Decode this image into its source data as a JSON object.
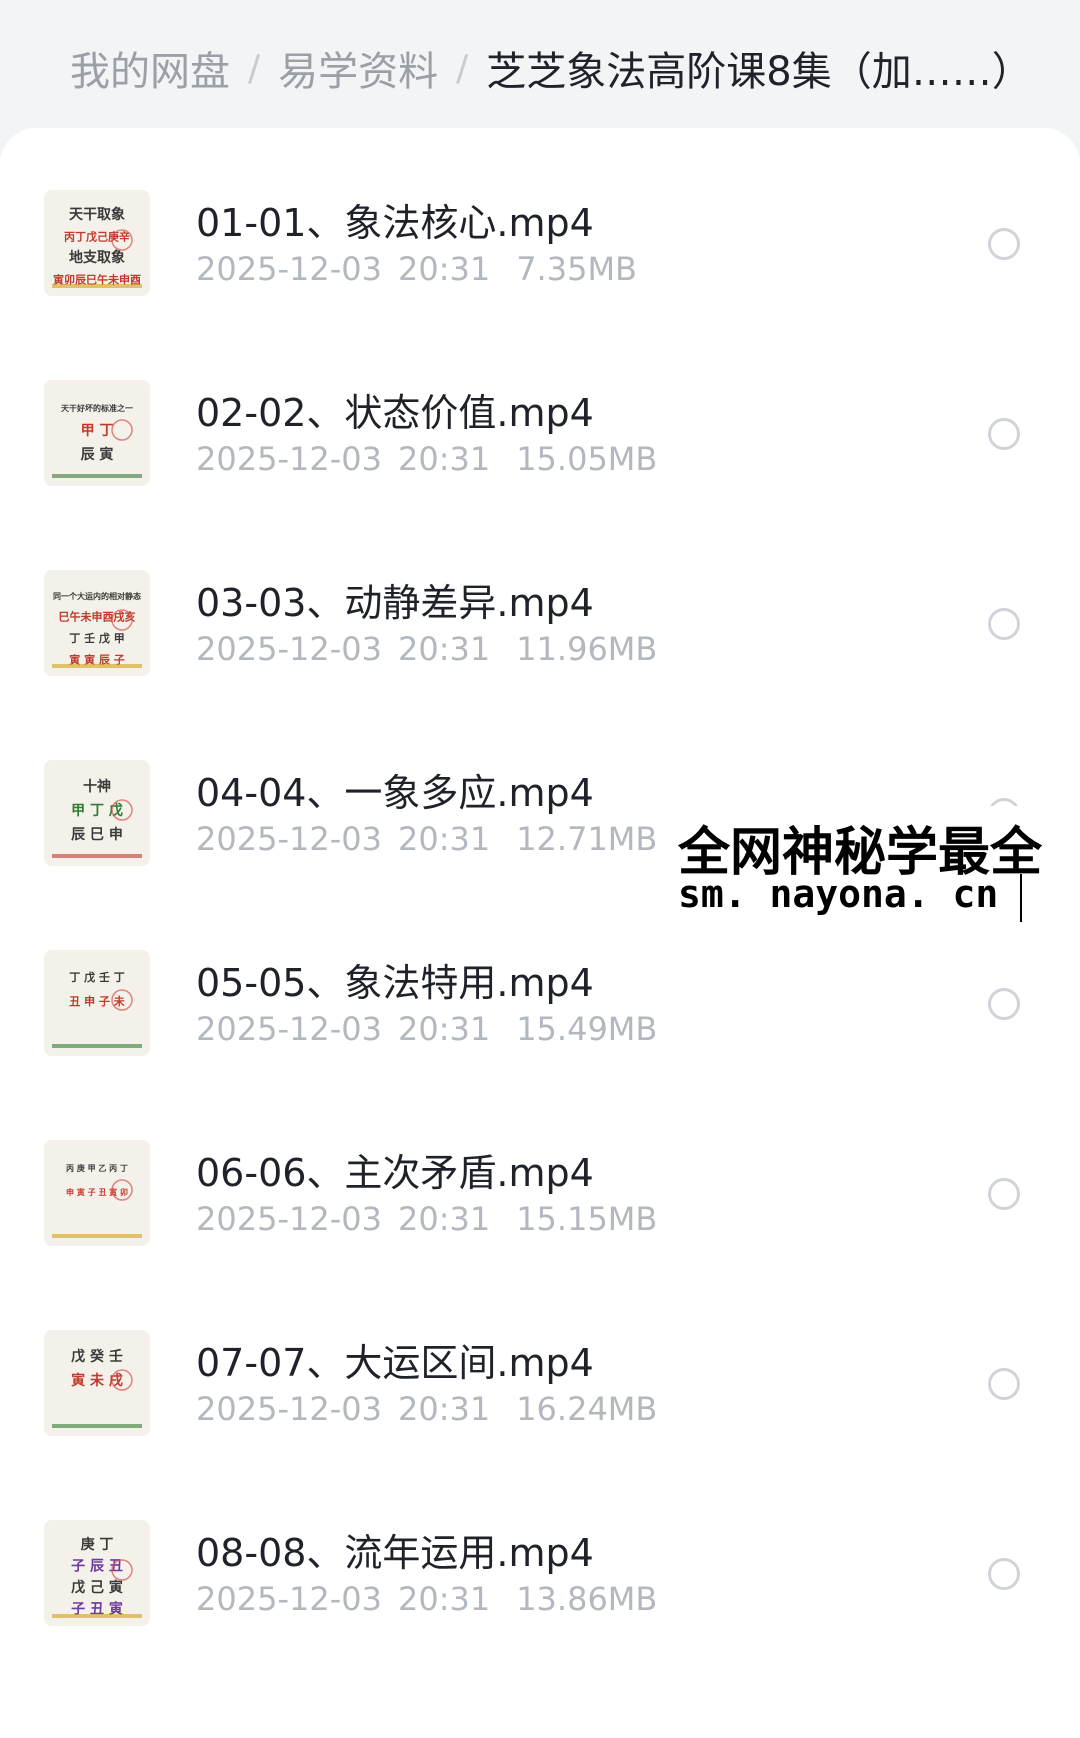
{
  "breadcrumb": {
    "items": [
      "我的网盘",
      "易学资料",
      "芝芝象法高阶课8集（加……）"
    ],
    "separator": "/"
  },
  "files": [
    {
      "name": "01-01、象法核心.mp4",
      "date": "2025-12-03",
      "time": "20:31",
      "size": "7.35MB"
    },
    {
      "name": "02-02、状态价值.mp4",
      "date": "2025-12-03",
      "time": "20:31",
      "size": "15.05MB"
    },
    {
      "name": "03-03、动静差异.mp4",
      "date": "2025-12-03",
      "time": "20:31",
      "size": "11.96MB"
    },
    {
      "name": "04-04、一象多应.mp4",
      "date": "2025-12-03",
      "time": "20:31",
      "size": "12.71MB"
    },
    {
      "name": "05-05、象法特用.mp4",
      "date": "2025-12-03",
      "time": "20:31",
      "size": "15.49MB"
    },
    {
      "name": "06-06、主次矛盾.mp4",
      "date": "2025-12-03",
      "time": "20:31",
      "size": "15.15MB"
    },
    {
      "name": "07-07、大运区间.mp4",
      "date": "2025-12-03",
      "time": "20:31",
      "size": "16.24MB"
    },
    {
      "name": "08-08、流年运用.mp4",
      "date": "2025-12-03",
      "time": "20:31",
      "size": "13.86MB"
    }
  ],
  "thumbnails": [
    {
      "lines": [
        "天干取象",
        "丙丁戊己庚辛",
        "地支取象",
        "寅卯辰巳午未申酉"
      ],
      "accent": [
        "#c0392b",
        "#d4a017"
      ]
    },
    {
      "lines": [
        "天干好坏的标准之一",
        "甲 丁",
        "辰 寅"
      ],
      "accent": [
        "#c0392b",
        "#3b7a3b"
      ]
    },
    {
      "lines": [
        "同一个大运内的相对静态",
        "巳午未申酉戌亥",
        "丁 壬 戊 甲",
        "寅 寅 辰 子"
      ],
      "accent": [
        "#c0392b",
        "#d4a017"
      ]
    },
    {
      "lines": [
        "十神",
        "甲 丁 戊",
        "辰 巳 申"
      ],
      "accent": [
        "#2e7d32",
        "#c0392b"
      ]
    },
    {
      "lines": [
        "丁 戊 壬 丁",
        "丑 申 子 未"
      ],
      "accent": [
        "#c0392b",
        "#2e7d32"
      ]
    },
    {
      "lines": [
        "丙 庚 甲 乙 丙 丁",
        "申 寅 子 丑 寅 卯"
      ],
      "accent": [
        "#c0392b",
        "#d4a017"
      ]
    },
    {
      "lines": [
        "戊 癸 壬",
        "寅 未 戌"
      ],
      "accent": [
        "#c0392b",
        "#2e7d32"
      ]
    },
    {
      "lines": [
        "庚 丁",
        "子 辰 丑",
        "戊 己 寅",
        "子 丑 寅"
      ],
      "accent": [
        "#6a3d9a",
        "#d4a017"
      ]
    }
  ],
  "watermark": {
    "line1": "全网神秘学最全",
    "line2": "sm. nayona. cn"
  },
  "colors": {
    "background": "#f3f4f6",
    "panel": "#ffffff",
    "title_text": "#1f2329",
    "meta_text": "#b3b8bf",
    "breadcrumb_inactive": "#9aa0a6",
    "radio_border": "#d0d4d9"
  }
}
